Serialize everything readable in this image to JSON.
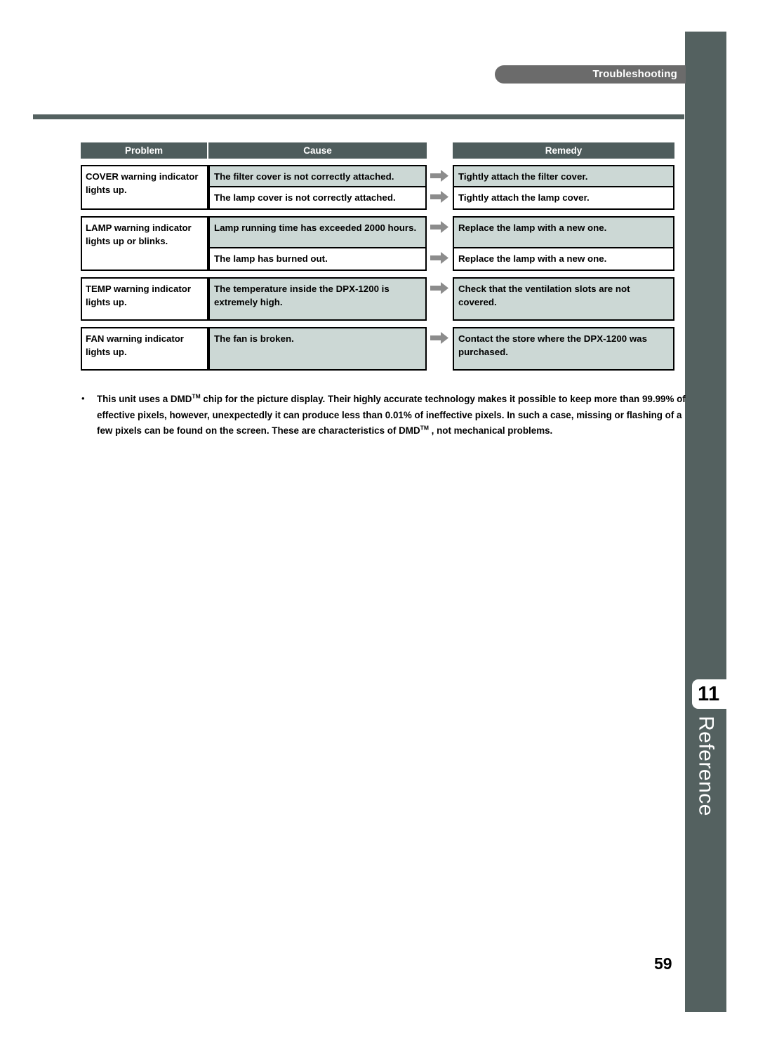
{
  "header": {
    "section_label": "Troubleshooting"
  },
  "sidebar": {
    "chapter_number": "11",
    "chapter_name": "Reference"
  },
  "table": {
    "columns": [
      "Problem",
      "Cause",
      "Remedy"
    ],
    "arrow_icon": "right-arrow-icon",
    "groups": [
      {
        "problem": "COVER warning indicator lights up.",
        "rows": [
          {
            "cause": "The filter cover is not correctly attached.",
            "remedy": "Tightly attach the filter cover.",
            "shaded": true
          },
          {
            "cause": "The lamp cover is not correctly attached.",
            "remedy": "Tightly attach the lamp cover.",
            "shaded": false
          }
        ]
      },
      {
        "problem": "LAMP warning indicator lights up or blinks.",
        "rows": [
          {
            "cause": "Lamp running time has exceeded 2000 hours.",
            "remedy": "Replace the lamp with a new one.",
            "shaded": true
          },
          {
            "cause": "The lamp has burned out.",
            "remedy": "Replace the lamp with a new one.",
            "shaded": false
          }
        ]
      },
      {
        "problem": "TEMP warning indicator lights up.",
        "rows": [
          {
            "cause": "The temperature inside the DPX-1200 is extremely high.",
            "remedy": "Check that the ventilation slots are not covered.",
            "shaded": true
          }
        ]
      },
      {
        "problem": "FAN warning indicator lights up.",
        "rows": [
          {
            "cause": "The fan is broken.",
            "remedy": "Contact the store where the DPX-1200 was purchased.",
            "shaded": true
          }
        ]
      }
    ]
  },
  "note": {
    "bullet_glyph": "•",
    "part1": "This unit uses a DMD",
    "tm1": "TM",
    "part2": " chip for the picture display. Their highly accurate technology makes it possible to keep more than 99.99% of effective pixels, however, unexpectedly it can produce less than 0.01% of ineffective pixels. In such a case, missing or flashing of a few pixels can be found on the screen. These are characteristics of DMD",
    "tm2": "TM",
    "part3": " , not mechanical problems."
  },
  "footer": {
    "page_number": "59"
  },
  "colors": {
    "dark_slate": "#546160",
    "header_row": "#4e5c5c",
    "pill_gray": "#6b6b6b",
    "shaded_cell": "#ccd8d5",
    "arrow_gray": "#8c8c8c"
  }
}
